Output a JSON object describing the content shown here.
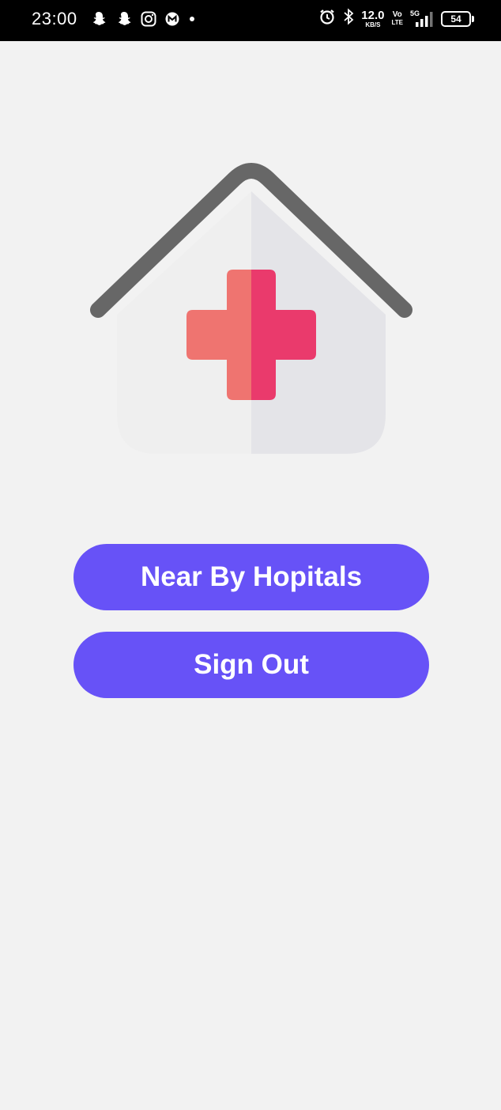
{
  "status_bar": {
    "time": "23:00",
    "network_speed_value": "12.0",
    "network_speed_unit": "KB/S",
    "volte_top": "Vo",
    "volte_bottom": "LTE",
    "signal_tag": "5G",
    "battery_level": "54",
    "left_icons": [
      "snapchat-icon",
      "snapchat-icon",
      "instagram-icon",
      "m-app-icon",
      "dot-icon"
    ],
    "right_icons": [
      "alarm-icon",
      "bluetooth-icon",
      "signal-icon",
      "battery-icon"
    ]
  },
  "main": {
    "illustration": "hospital-house-icon",
    "buttons": {
      "near_by_hospitals": "Near By Hopitals",
      "sign_out": "Sign Out"
    }
  },
  "colors": {
    "background": "#f2f2f2",
    "button": "#6752f7",
    "button_text": "#ffffff",
    "roof": "#666666",
    "house_left": "#efefef",
    "house_right": "#e4e4e8",
    "cross_left": "#ef7470",
    "cross_right": "#ea3a6c"
  }
}
